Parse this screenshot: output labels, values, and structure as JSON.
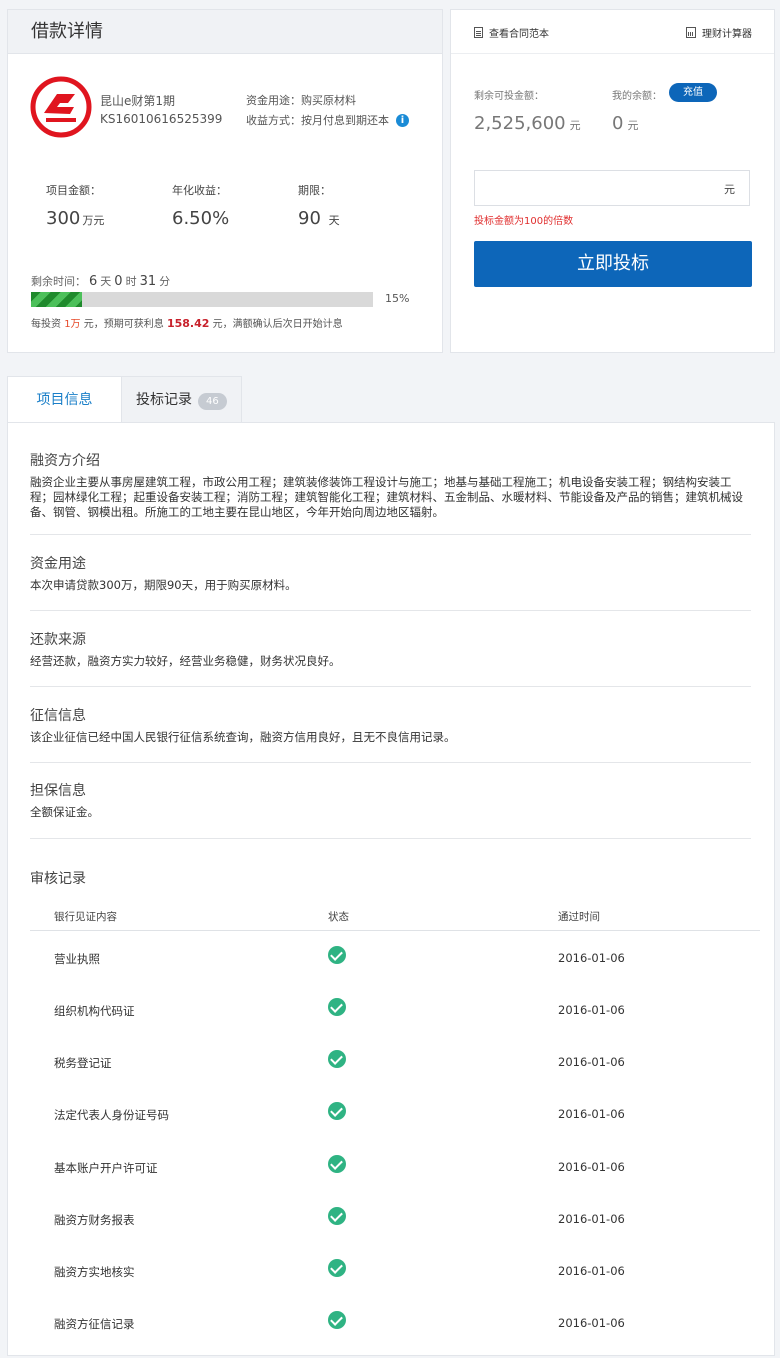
{
  "loan": {
    "title": "借款详情",
    "product_name": "昆山e财第1期",
    "product_code": "KS16010616525399",
    "use_label": "资金用途：",
    "use_value": "购买原材料",
    "repay_label": "收益方式：",
    "repay_value": "按月付息到期还本",
    "amount_label": "项目金额：",
    "amount_value": "300",
    "amount_unit": "万元",
    "rate_label": "年化收益：",
    "rate_value": "6.50%",
    "term_label": "期限：",
    "term_value": "90",
    "term_unit": "天",
    "remain_label": "剩余时间：",
    "remain_days": "6",
    "remain_days_unit": "天",
    "remain_hours": "0",
    "remain_hours_unit": "时",
    "remain_minutes": "31",
    "remain_minutes_unit": "分",
    "progress_percent": 15,
    "progress_text": "15%",
    "per_invest_prefix": "每投资",
    "per_invest_amount": "1万",
    "per_invest_mid": "元，预期可获利息",
    "per_invest_interest": "158.42",
    "per_invest_suffix": "元，满额确认后次日开始计息"
  },
  "invest": {
    "contract_link": "查看合同范本",
    "calc_link": "理财计算器",
    "available_label": "剩余可投金额：",
    "available_value": "2,525,600",
    "available_unit": "元",
    "balance_label": "我的余额：",
    "topup_button": "充值",
    "balance_value": "0",
    "balance_unit": "元",
    "input_placeholder": "",
    "input_unit": "元",
    "hint": "投标金额为100的倍数",
    "submit_button": "立即投标"
  },
  "tabs": {
    "project_info": "项目信息",
    "bid_records": "投标记录",
    "bid_count": "46"
  },
  "sections": [
    {
      "title": "融资方介绍",
      "text": "融资企业主要从事房屋建筑工程，市政公用工程；建筑装修装饰工程设计与施工；地基与基础工程施工；机电设备安装工程；钢结构安装工程；园林绿化工程；起重设备安装工程；消防工程；建筑智能化工程；建筑材料、五金制品、水暖材料、节能设备及产品的销售；建筑机械设备、钢管、钢模出租。所施工的工地主要在昆山地区，今年开始向周边地区辐射。"
    },
    {
      "title": "资金用途",
      "text": "本次申请贷款300万，期限90天，用于购买原材料。"
    },
    {
      "title": "还款来源",
      "text": "经营还款，融资方实力较好，经营业务稳健，财务状况良好。"
    },
    {
      "title": "征信信息",
      "text": "该企业征信已经中国人民银行征信系统查询，融资方信用良好，且无不良信用记录。"
    },
    {
      "title": "担保信息",
      "text": "全额保证金。"
    }
  ],
  "audit": {
    "title": "审核记录",
    "headers": [
      "银行见证内容",
      "状态",
      "通过时间"
    ],
    "rows": [
      {
        "item": "营业执照",
        "date": "2016-01-06"
      },
      {
        "item": "组织机构代码证",
        "date": "2016-01-06"
      },
      {
        "item": "税务登记证",
        "date": "2016-01-06"
      },
      {
        "item": "法定代表人身份证号码",
        "date": "2016-01-06"
      },
      {
        "item": "基本账户开户许可证",
        "date": "2016-01-06"
      },
      {
        "item": "融资方财务报表",
        "date": "2016-01-06"
      },
      {
        "item": "融资方实地核实",
        "date": "2016-01-06"
      },
      {
        "item": "融资方征信记录",
        "date": "2016-01-06"
      }
    ]
  },
  "colors": {
    "brand_blue": "#0d66b9",
    "progress_green": "#4cc05a",
    "check_green": "#2fb383",
    "logo_red": "#e0151f",
    "warning_red": "#e02d2d"
  }
}
